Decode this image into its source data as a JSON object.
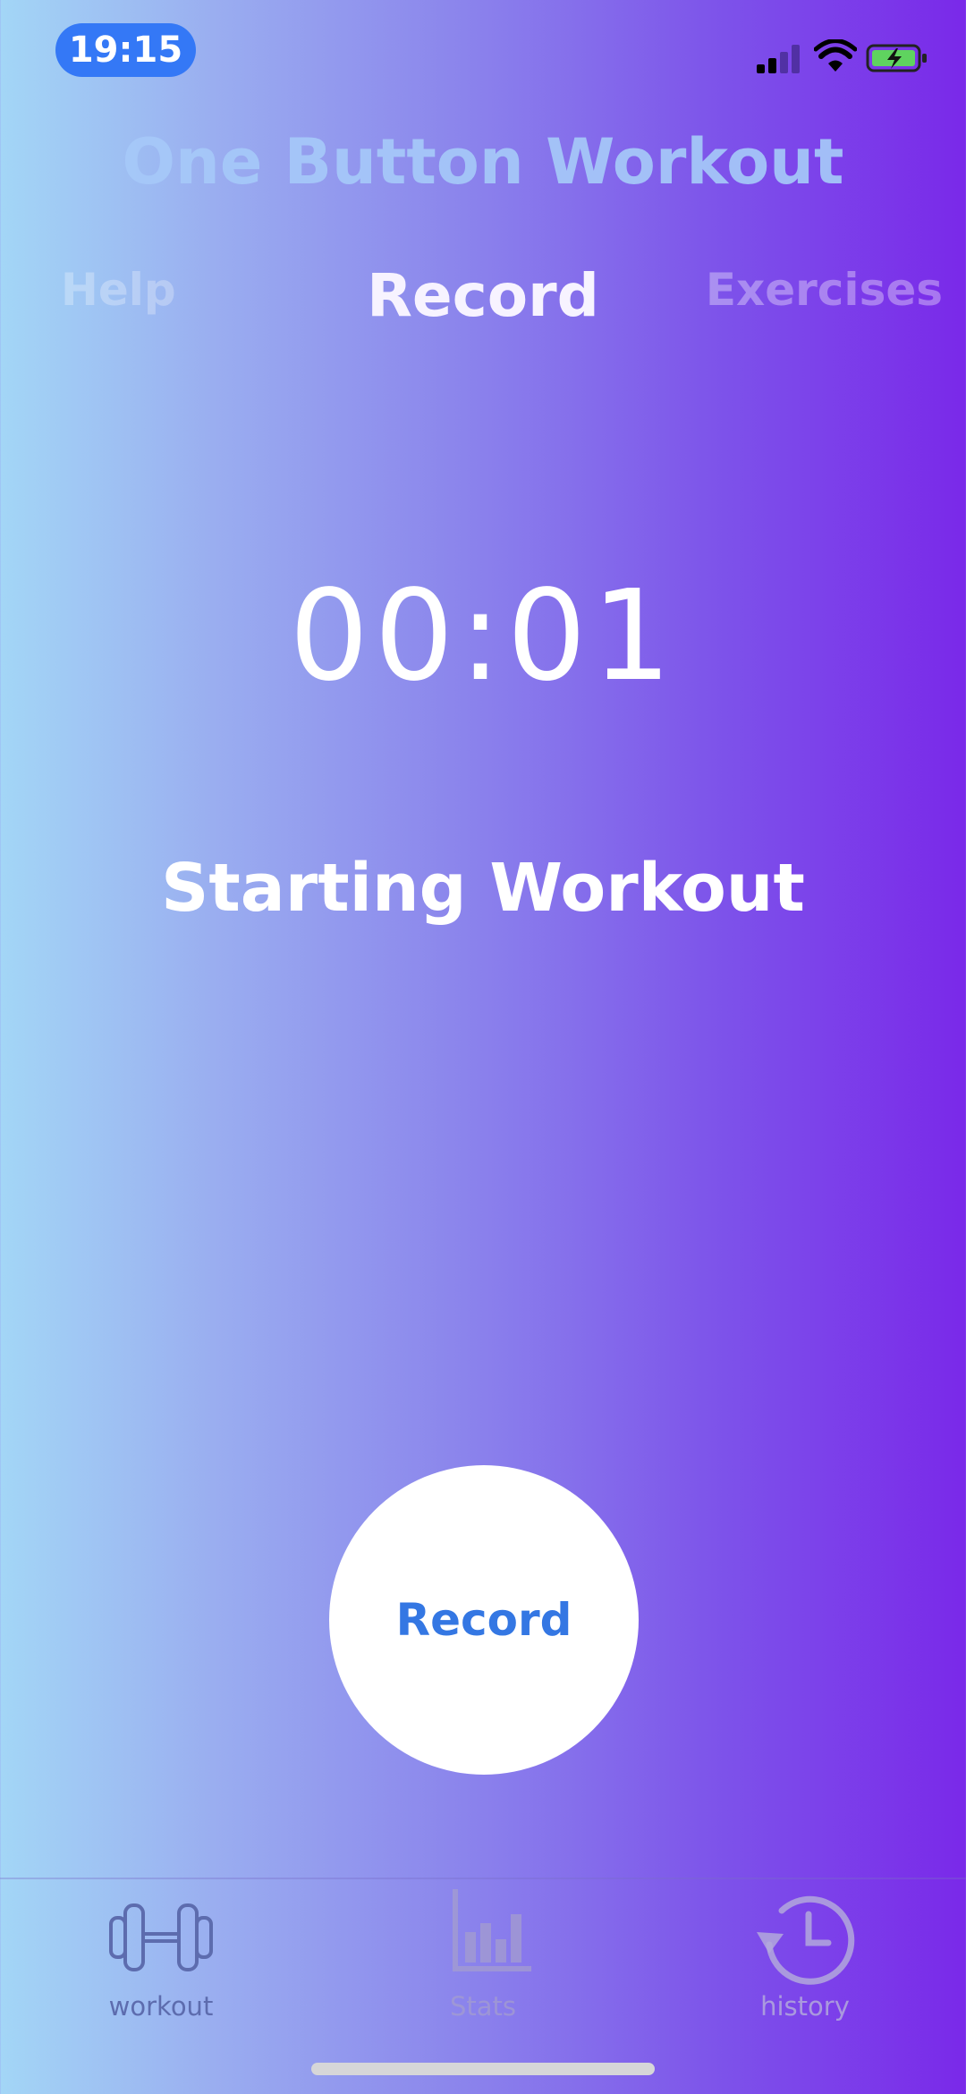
{
  "status_bar": {
    "time": "19:15"
  },
  "header": {
    "title": "One Button Workout",
    "tabs": {
      "help": "Help",
      "record": "Record",
      "exercises": "Exercises"
    }
  },
  "main": {
    "timer": "00:01",
    "status": "Starting Workout",
    "record_button": "Record"
  },
  "tab_bar": {
    "items": [
      {
        "label": "workout",
        "icon": "dumbbell-icon"
      },
      {
        "label": "Stats",
        "icon": "bar-chart-icon"
      },
      {
        "label": "history",
        "icon": "history-clock-icon"
      }
    ]
  },
  "colors": {
    "accent_blue": "#3478f6",
    "gradient_left": "#a3d6f6",
    "gradient_right": "#7a29e9",
    "battery_green": "#5fd35f"
  }
}
